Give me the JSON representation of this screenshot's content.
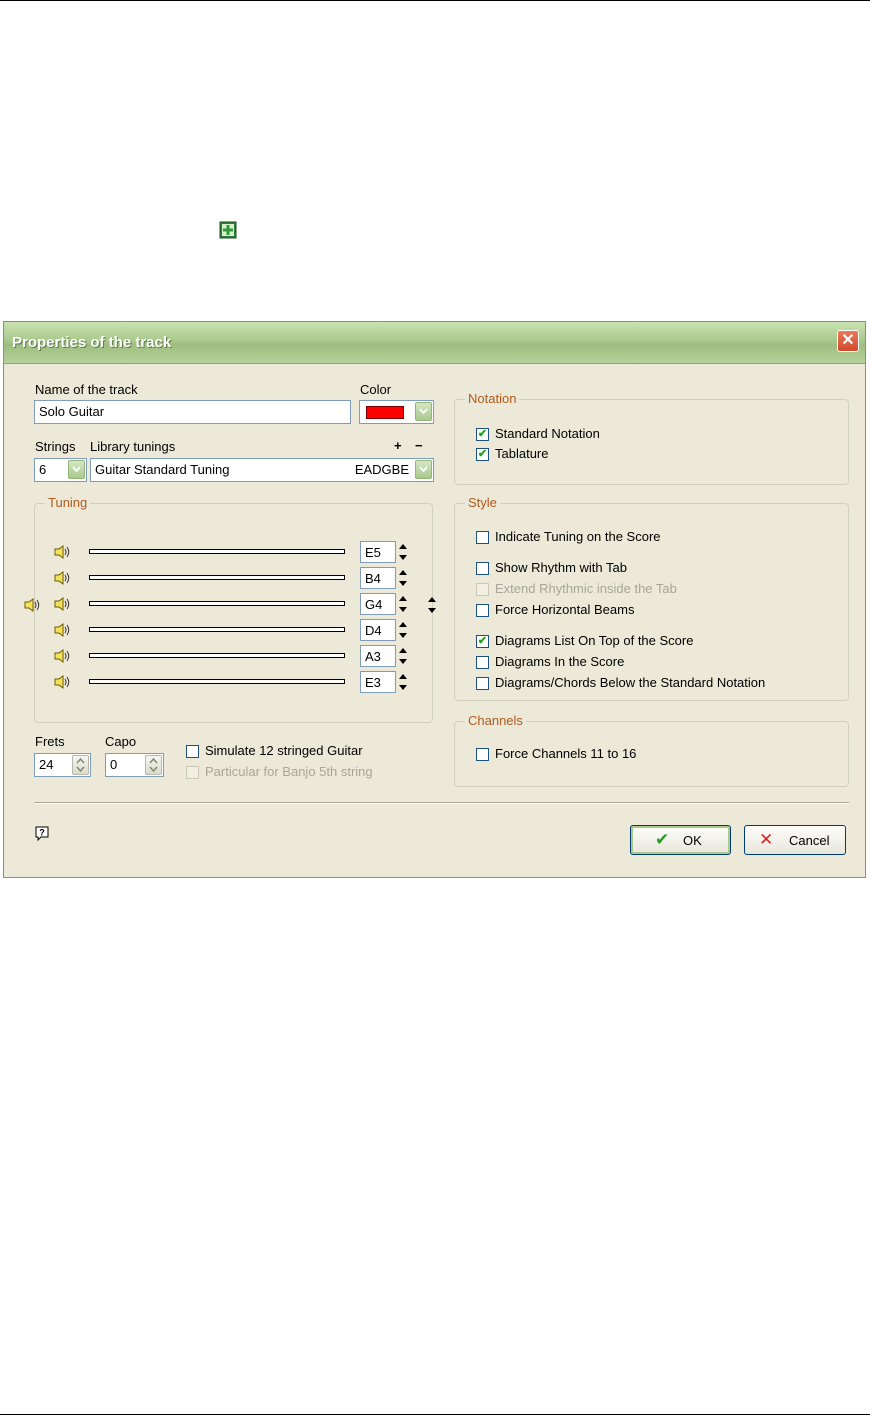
{
  "dialog": {
    "title": "Properties of the track",
    "close_label": "✕",
    "track_name_label": "Name of the track",
    "track_name_value": "Solo Guitar",
    "color_label": "Color",
    "color_value": "#ff0000",
    "strings_label": "Strings",
    "strings_value": "6",
    "library_label": "Library tunings",
    "library_plus": "+",
    "library_minus": "−",
    "library_value": "Guitar Standard Tuning",
    "library_notes": "EADGBE",
    "tuning": {
      "title": "Tuning",
      "strings": [
        "E5",
        "B4",
        "G4",
        "D4",
        "A3",
        "E3"
      ]
    },
    "frets_label": "Frets",
    "frets_value": "24",
    "capo_label": "Capo",
    "capo_value": "0",
    "simulate12_label": "Simulate 12 stringed Guitar",
    "banjo_label": "Particular for Banjo 5th string",
    "notation": {
      "title": "Notation",
      "items": [
        {
          "label": "Standard Notation",
          "checked": true
        },
        {
          "label": "Tablature",
          "checked": true
        }
      ]
    },
    "style": {
      "title": "Style",
      "items": [
        {
          "label": "Indicate Tuning on the Score",
          "checked": false,
          "disabled": false
        },
        {
          "label": "Show Rhythm with Tab",
          "checked": false,
          "disabled": false
        },
        {
          "label": "Extend Rhythmic inside the Tab",
          "checked": false,
          "disabled": true
        },
        {
          "label": "Force Horizontal Beams",
          "checked": false,
          "disabled": false
        },
        {
          "label": "Diagrams List On Top of the Score",
          "checked": true,
          "disabled": false
        },
        {
          "label": "Diagrams In the Score",
          "checked": false,
          "disabled": false
        },
        {
          "label": "Diagrams/Chords Below the Standard Notation",
          "checked": false,
          "disabled": false
        }
      ]
    },
    "channels": {
      "title": "Channels",
      "force_label": "Force Channels 11 to 16"
    },
    "ok_label": "OK",
    "cancel_label": "Cancel"
  }
}
